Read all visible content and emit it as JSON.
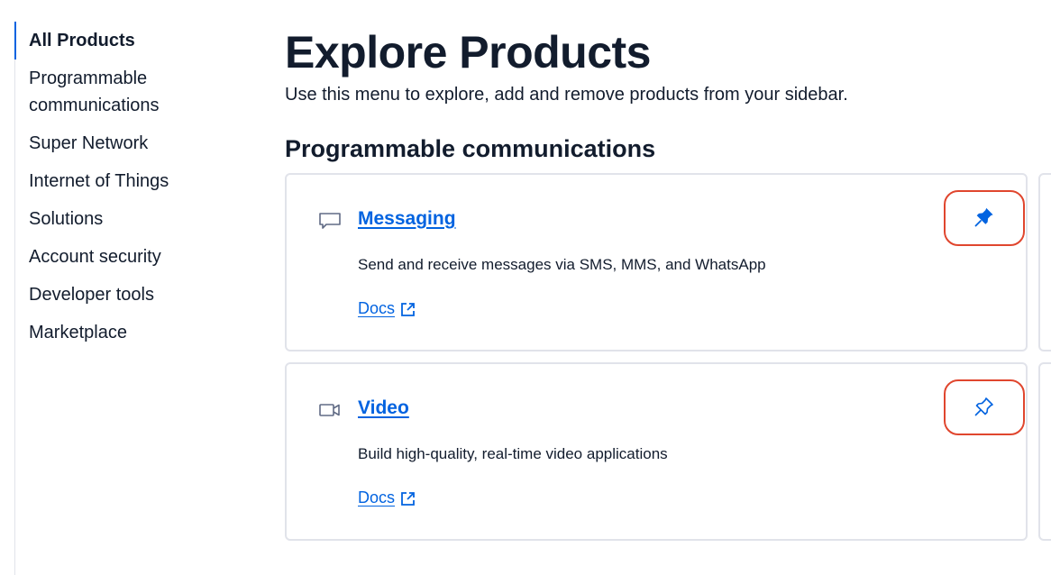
{
  "sidebar": {
    "items": [
      {
        "label": "All Products",
        "active": true
      },
      {
        "label": "Programmable communications",
        "active": false
      },
      {
        "label": "Super Network",
        "active": false
      },
      {
        "label": "Internet of Things",
        "active": false
      },
      {
        "label": "Solutions",
        "active": false
      },
      {
        "label": "Account security",
        "active": false
      },
      {
        "label": "Developer tools",
        "active": false
      },
      {
        "label": "Marketplace",
        "active": false
      }
    ]
  },
  "main": {
    "title": "Explore Products",
    "subtitle": "Use this menu to explore, add and remove products from your sidebar.",
    "section_title": "Programmable communications",
    "products": [
      {
        "name": "Messaging",
        "icon": "chat-bubble-icon",
        "description": "Send and receive messages via SMS, MMS, and WhatsApp",
        "docs_label": "Docs",
        "pinned": true
      },
      {
        "name": "Video",
        "icon": "video-camera-icon",
        "description": "Build high-quality, real-time video applications",
        "docs_label": "Docs",
        "pinned": false
      }
    ]
  },
  "colors": {
    "accent": "#0263e0",
    "text": "#121c2d",
    "border": "#e1e3ea",
    "highlight": "#e0462e",
    "icon_muted": "#606b85"
  }
}
